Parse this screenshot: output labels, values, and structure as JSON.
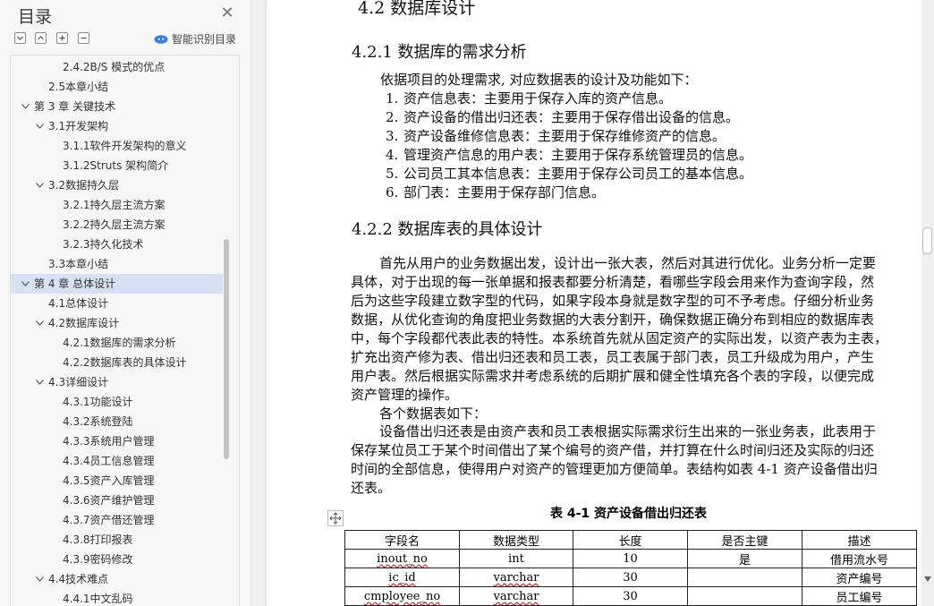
{
  "sidebar": {
    "title": "目录",
    "smart_toc_label": "智能识别目录",
    "items": [
      {
        "label": "2.4.2B/S 模式的优点",
        "level": 3
      },
      {
        "label": "2.5本章小结",
        "level": 2
      },
      {
        "label": "第 3 章  关键技术",
        "level": 1,
        "expanded": true
      },
      {
        "label": "3.1开发架构",
        "level": 2,
        "expanded": true
      },
      {
        "label": "3.1.1软件开发架构的意义",
        "level": 3
      },
      {
        "label": "3.1.2Struts 架构简介",
        "level": 3
      },
      {
        "label": "3.2数据持久层",
        "level": 2,
        "expanded": true
      },
      {
        "label": "3.2.1持久层主流方案",
        "level": 3
      },
      {
        "label": "3.2.2持久层主流方案",
        "level": 3
      },
      {
        "label": "3.2.3持久化技术",
        "level": 3
      },
      {
        "label": "3.3本章小结",
        "level": 2
      },
      {
        "label": "第 4 章  总体设计",
        "level": 1,
        "expanded": true,
        "selected": true
      },
      {
        "label": "4.1总体设计",
        "level": 2
      },
      {
        "label": "4.2数据库设计",
        "level": 2,
        "expanded": true
      },
      {
        "label": "4.2.1数据库的需求分析",
        "level": 3
      },
      {
        "label": "4.2.2数据库表的具体设计",
        "level": 3
      },
      {
        "label": "4.3详细设计",
        "level": 2,
        "expanded": true
      },
      {
        "label": "4.3.1功能设计",
        "level": 3
      },
      {
        "label": "4.3.2系统登陆",
        "level": 3
      },
      {
        "label": "4.3.3系统用户管理",
        "level": 3
      },
      {
        "label": "4.3.4员工信息管理",
        "level": 3
      },
      {
        "label": "4.3.5资产入库管理",
        "level": 3
      },
      {
        "label": "4.3.6资产维护管理",
        "level": 3
      },
      {
        "label": "4.3.7资产借还管理",
        "level": 3
      },
      {
        "label": "4.3.8打印报表",
        "level": 3
      },
      {
        "label": "4.3.9密码修改",
        "level": 3
      },
      {
        "label": "4.4技术难点",
        "level": 2,
        "expanded": true
      },
      {
        "label": "4.4.1中文乱码",
        "level": 3
      }
    ]
  },
  "document": {
    "section_4_2": "4.2  数据库设计",
    "section_4_2_1": "4.2.1  数据库的需求分析",
    "req_intro": "依据项目的处理需求, 对应数据表的设计及功能如下：",
    "req_list": [
      {
        "num": "1.",
        "text": "资产信息表：主要用于保存入库的资产信息。"
      },
      {
        "num": "2.",
        "text": "资产设备的借出归还表：主要用于保存借出设备的信息。"
      },
      {
        "num": "3.",
        "text": "资产设备维修信息表：主要用于保存维修资产的信息。"
      },
      {
        "num": "4.",
        "text": "管理资产信息的用户表：主要用于保存系统管理员的信息。"
      },
      {
        "num": "5.",
        "text": "公司员工其本信息表：主要用于保存公司员工的基本信息。"
      },
      {
        "num": "6.",
        "text": "部门表：主要用于保存部门信息。"
      }
    ],
    "section_4_2_2": "4.2.2  数据库表的具体设计",
    "para1_lines": [
      "首先从用户的业务数据出发，设计出一张大表，然后对其进行优化。业务分析一定要",
      "具体，对于出现的每一张单据和报表都要分析清楚，看哪些字段会用来作为查询字段，然",
      "后为这些字段建立数字型的代码，如果字段本身就是数字型的可不予考虑。仔细分析业务",
      "数据，从优化查询的角度把业务数据的大表分割开，确保数据正确分布到相应的数据库表",
      "中，每个字段都代表此表的特性。本系统首先就从固定资产的实际出发，以资产表为主表，",
      "扩充出资产修为表、借出归还表和员工表，员工表属于部门表，员工升级成为用户，产生",
      "用户表。然后根据实际需求并考虑系统的后期扩展和健全性填充各个表的字段，以便完成",
      "资产管理的操作。"
    ],
    "para2": "各个数据表如下：",
    "para3_lines": [
      "设备借出归还表是由资产表和员工表根据实际需求衍生出来的一张业务表，此表用于",
      "保存某位员工于某个时间借出了某个编号的资产借，并打算在什么时间归还及实际的归还",
      "时间的全部信息，使得用户对资产的管理更加方便简单。表结构如表 4-1 资产设备借出归",
      "还表。"
    ],
    "table_caption": "表 4-1   资产设备借出归还表",
    "table": {
      "headers": [
        "字段名",
        "数据类型",
        "长度",
        "是否主键",
        "描述"
      ],
      "rows": [
        [
          "inout_no",
          "int",
          "10",
          "是",
          "借用流水号"
        ],
        [
          "ic_id",
          "varchar",
          "30",
          "",
          "资产编号"
        ],
        [
          "cmployee_no",
          "varchar",
          "30",
          "",
          "员工编号"
        ]
      ]
    }
  }
}
